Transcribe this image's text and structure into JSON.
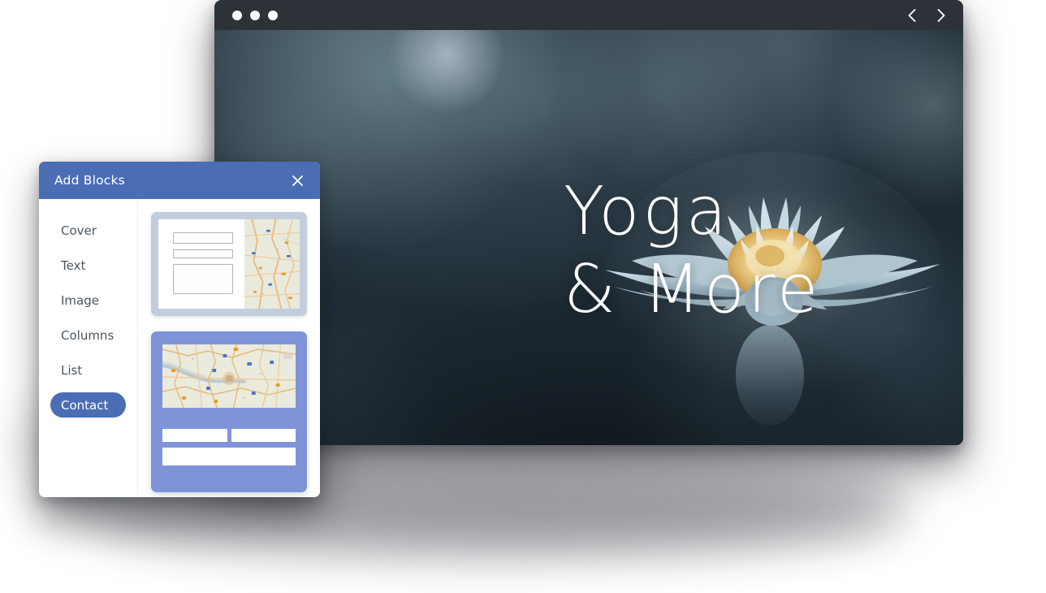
{
  "browser": {
    "traffic_lights": [
      "window-dot-1",
      "window-dot-2",
      "window-dot-3"
    ],
    "nav_prev_icon": "chevron-left-icon",
    "nav_next_icon": "chevron-right-icon"
  },
  "hero": {
    "title_line_1": "Yoga",
    "title_line_2": "& More",
    "image_subject": "water-lily-flower",
    "accent_colors": {
      "background_dark": "#1b2731",
      "background_light": "#4e6472",
      "petal": "#b9cdd6",
      "center_gold": "#e8c379"
    }
  },
  "dialog": {
    "title": "Add Blocks",
    "close_icon": "close-icon",
    "header_color": "#4a6db4",
    "sidebar": {
      "items": [
        {
          "label": "Cover",
          "selected": false
        },
        {
          "label": "Text",
          "selected": false
        },
        {
          "label": "Image",
          "selected": false
        },
        {
          "label": "Columns",
          "selected": false
        },
        {
          "label": "List",
          "selected": false
        },
        {
          "label": "Contact",
          "selected": true
        }
      ]
    },
    "previews": [
      {
        "name": "contact-form-with-side-map",
        "selected": false,
        "frame_color": "#c2cddd",
        "background": "#ffffff",
        "fields": 3,
        "map_position": "right"
      },
      {
        "name": "contact-form-with-top-map",
        "selected": true,
        "frame_color": "#8093d8",
        "background": "#8093d8",
        "fields": 3,
        "map_position": "top"
      }
    ]
  }
}
